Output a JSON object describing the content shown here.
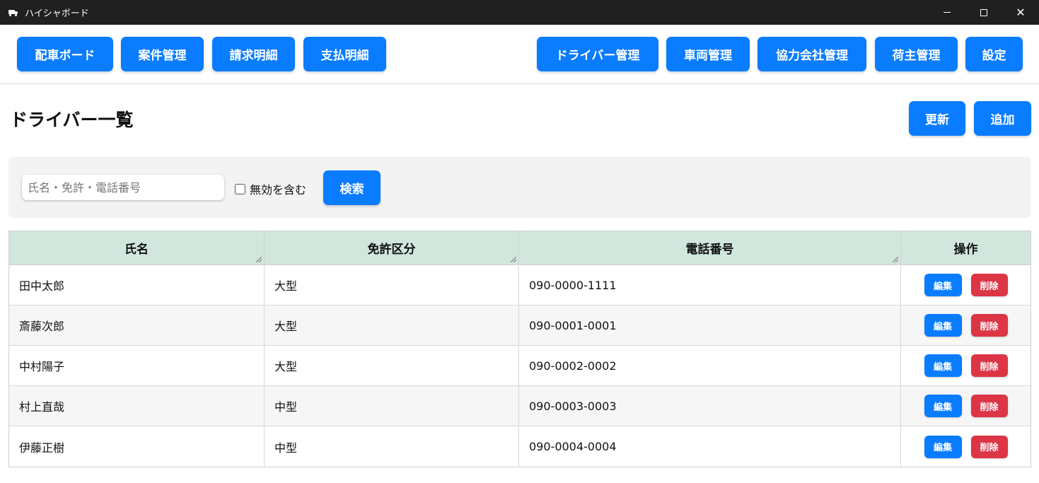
{
  "window": {
    "title": "ハイシャボード",
    "close_glyph": "✕"
  },
  "nav": {
    "left": [
      {
        "label": "配車ボード"
      },
      {
        "label": "案件管理"
      },
      {
        "label": "請求明細"
      },
      {
        "label": "支払明細"
      }
    ],
    "right": [
      {
        "label": "ドライバー管理"
      },
      {
        "label": "車両管理"
      },
      {
        "label": "協力会社管理"
      },
      {
        "label": "荷主管理"
      },
      {
        "label": "設定"
      }
    ]
  },
  "page": {
    "title": "ドライバー一覧",
    "refresh_label": "更新",
    "add_label": "追加"
  },
  "search": {
    "placeholder": "氏名・免許・電話番号",
    "value": "",
    "include_inactive_label": "無効を含む",
    "include_inactive_checked": false,
    "button_label": "検索"
  },
  "table": {
    "columns": [
      "氏名",
      "免許区分",
      "電話番号",
      "操作"
    ],
    "rows": [
      {
        "name": "田中太郎",
        "license": "大型",
        "phone": "090-0000-1111"
      },
      {
        "name": "斎藤次郎",
        "license": "大型",
        "phone": "090-0001-0001"
      },
      {
        "name": "中村陽子",
        "license": "大型",
        "phone": "090-0002-0002"
      },
      {
        "name": "村上直哉",
        "license": "中型",
        "phone": "090-0003-0003"
      },
      {
        "name": "伊藤正樹",
        "license": "中型",
        "phone": "090-0004-0004"
      }
    ],
    "edit_label": "編集",
    "delete_label": "削除"
  },
  "colors": {
    "primary": "#0a7cff",
    "danger": "#dc3545",
    "header_bg": "#d1e7dd",
    "titlebar": "#202020"
  }
}
